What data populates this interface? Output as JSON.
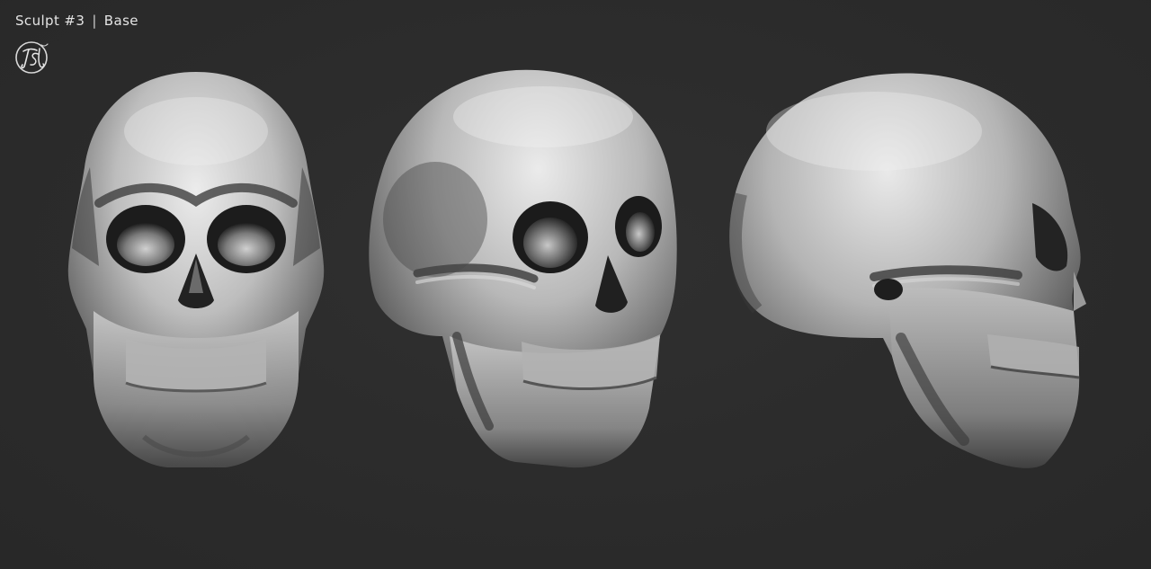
{
  "header": {
    "title": "Sculpt #3",
    "separator": "|",
    "subtitle": "Base"
  },
  "logo": {
    "icon": "signature-monogram-icon"
  },
  "views": [
    {
      "id": "front",
      "icon": "skull-front-view"
    },
    {
      "id": "three-quarter",
      "icon": "skull-three-quarter-view"
    },
    {
      "id": "side",
      "icon": "skull-side-view"
    }
  ],
  "colors": {
    "background": "#2b2b2b",
    "text": "#e4e4e4",
    "clay_light": "#e8e8e8",
    "clay_mid": "#9a9a9a",
    "clay_dark": "#3a3a3a"
  }
}
